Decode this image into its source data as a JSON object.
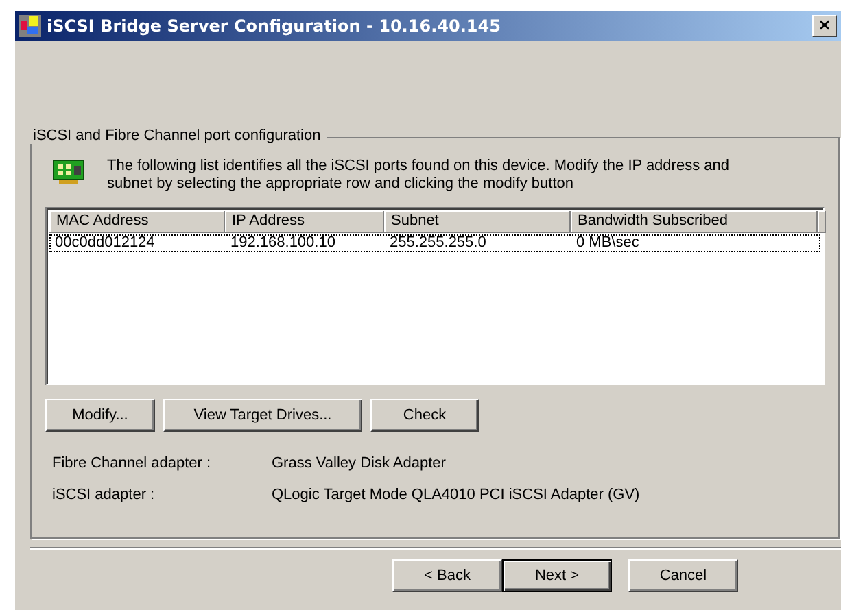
{
  "window": {
    "title": "iSCSI Bridge Server Configuration - 10.16.40.145",
    "close": "×"
  },
  "group": {
    "title": "iSCSI and Fibre Channel port configuration",
    "description": "The following list identifies all the iSCSI ports found on this device. Modify the IP address and subnet by selecting the appropriate row and clicking the modify button"
  },
  "table": {
    "columns": [
      "MAC Address",
      "IP Address",
      "Subnet",
      "Bandwidth Subscribed"
    ],
    "rows": [
      {
        "cells": [
          "00c0dd012124",
          "192.168.100.10",
          "255.255.255.0",
          "0 MB\\sec"
        ],
        "focused": true
      }
    ]
  },
  "actions": [
    {
      "label": "Modify..."
    },
    {
      "label": "View Target Drives..."
    },
    {
      "label": "Check"
    }
  ],
  "details": [
    {
      "label": "Fibre Channel adapter :",
      "value": "Grass Valley Disk Adapter"
    },
    {
      "label": "iSCSI adapter :",
      "value": "QLogic Target Mode QLA4010 PCI iSCSI Adapter (GV)"
    }
  ],
  "navigation": [
    {
      "label": "< Back",
      "default": false
    },
    {
      "label": "Next >",
      "default": true
    },
    {
      "label": "Cancel",
      "default": false
    }
  ]
}
